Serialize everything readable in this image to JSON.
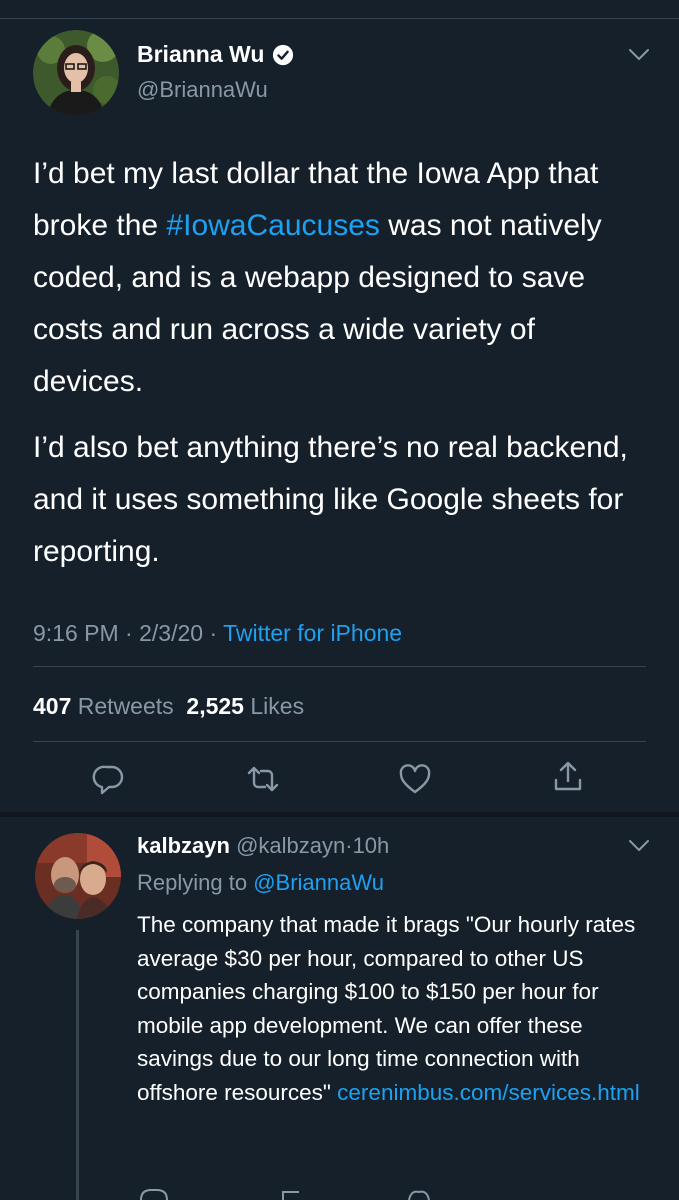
{
  "main_tweet": {
    "author_name": "Brianna Wu",
    "author_handle": "@BriannaWu",
    "verified": true,
    "body": {
      "p1_before": "I’d bet my last dollar that the Iowa App that broke the ",
      "hashtag": "#IowaCaucuses",
      "p1_after": " was not natively coded, and is a webapp designed to save costs and run across a wide variety of devices.",
      "p2": "I’d also bet anything there’s no real backend, and it uses something like Google sheets for reporting."
    },
    "time": "9:16 PM",
    "date": "2/3/20",
    "source": "Twitter for iPhone",
    "retweets_count": "407",
    "retweets_label": "Retweets",
    "likes_count": "2,525",
    "likes_label": "Likes"
  },
  "reply": {
    "author_name": "kalbzayn",
    "author_handle": "@kalbzayn",
    "age": "10h",
    "replying_to_label": "Replying to",
    "replying_to_handle": "@BriannaWu",
    "body_text": "The company that made it brags \"Our hourly rates average $30 per hour, compared to other US companies charging $100 to $150 per hour for mobile app development. We can offer these savings due to our long time connection with offshore resources\" ",
    "link": "cerenimbus.com/services.html"
  },
  "icons": {
    "caret": "chevron-down-icon",
    "verified": "verified-badge-icon",
    "reply": "reply-icon",
    "retweet": "retweet-icon",
    "like": "heart-icon",
    "share": "share-icon"
  },
  "colors": {
    "background": "#15202b",
    "text": "#ffffff",
    "secondary": "#8899a6",
    "accent": "#1da1f2",
    "divider": "#38444d"
  }
}
